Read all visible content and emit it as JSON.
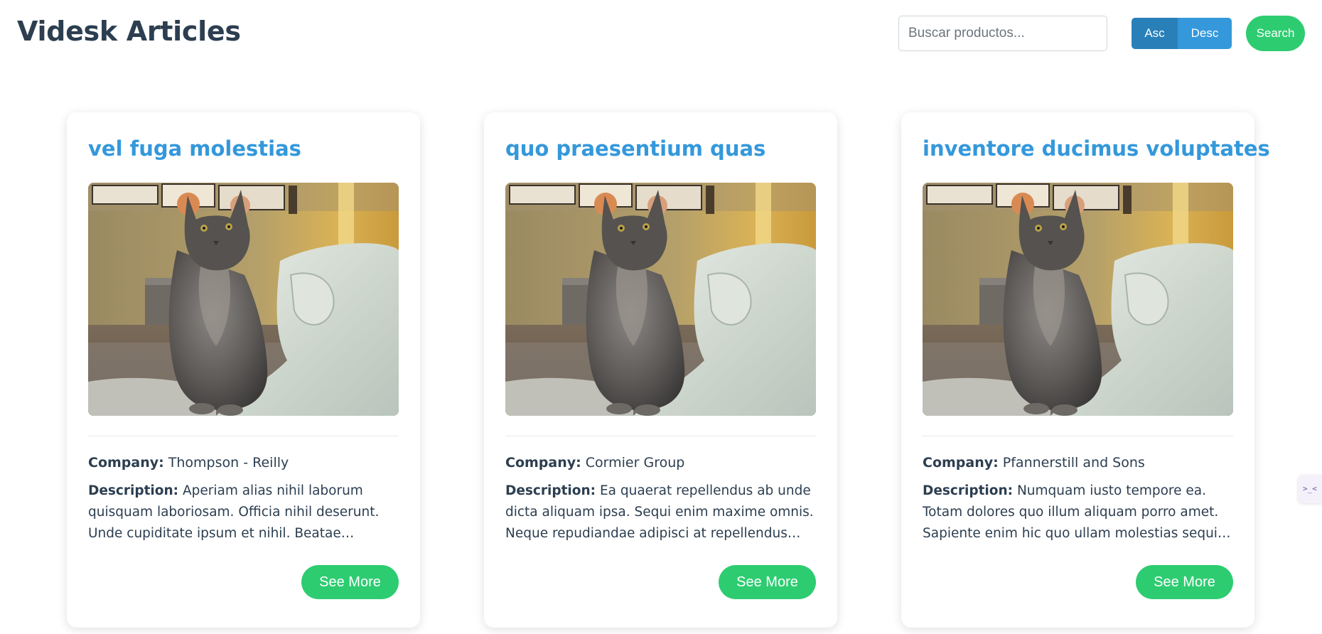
{
  "header": {
    "title": "Videsk Articles",
    "search_placeholder": "Buscar productos...",
    "sort_asc_label": "Asc",
    "sort_desc_label": "Desc",
    "search_button_label": "Search"
  },
  "labels": {
    "company": "Company:",
    "description": "Description:",
    "see_more": "See More"
  },
  "articles": [
    {
      "title": "vel fuga molestias",
      "company": "Thompson - Reilly",
      "description": "Aperiam alias nihil laborum quisquam laboriosam. Officia nihil deserunt. Unde cupiditate ipsum et nihil. Beatae maiores..."
    },
    {
      "title": "quo praesentium quas",
      "company": "Cormier Group",
      "description": "Ea quaerat repellendus ab unde dicta aliquam ipsa. Sequi enim maxime omnis. Neque repudiandae adipisci at repellendus ipsa..."
    },
    {
      "title": "inventore ducimus voluptates",
      "company": "Pfannerstill and Sons",
      "description": "Numquam iusto tempore ea. Totam dolores quo illum aliquam porro amet. Sapiente enim hic quo ullam molestias sequi perspiciatis..."
    }
  ],
  "side_widget": {
    "icon_text": ">_<"
  },
  "colors": {
    "heading": "#2c3e50",
    "accent_blue": "#3498db",
    "dark_blue": "#2980b9",
    "green": "#2ecc71"
  },
  "icons": {
    "card_image": "cat-photo",
    "side_widget": "terminal-icon"
  }
}
